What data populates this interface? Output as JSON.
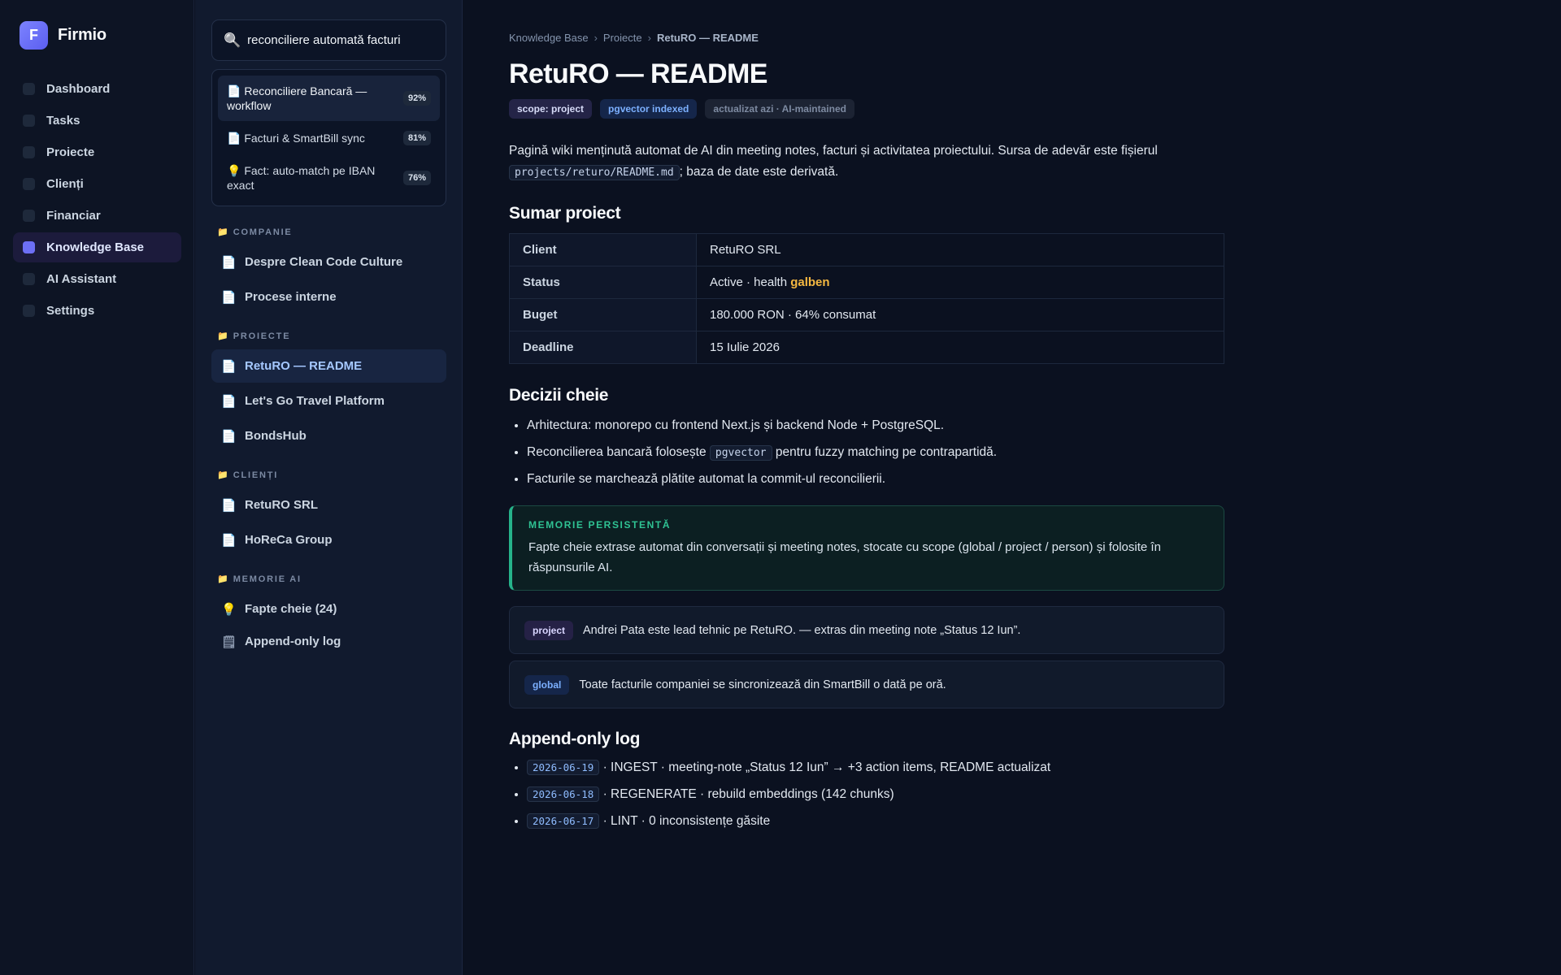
{
  "app": {
    "name": "Firmio",
    "logo_letter": "F"
  },
  "nav": {
    "items": [
      {
        "label": "Dashboard",
        "active": false
      },
      {
        "label": "Tasks",
        "active": false
      },
      {
        "label": "Proiecte",
        "active": false
      },
      {
        "label": "Clienți",
        "active": false
      },
      {
        "label": "Financiar",
        "active": false
      },
      {
        "label": "Knowledge Base",
        "active": true
      },
      {
        "label": "AI Assistant",
        "active": false
      },
      {
        "label": "Settings",
        "active": false
      }
    ]
  },
  "kb": {
    "search": {
      "value": "reconciliere automată facturi",
      "icon": "search-icon"
    },
    "results": [
      {
        "icon": "📄",
        "title": "Reconciliere Bancară — workflow",
        "score": "92%"
      },
      {
        "icon": "📄",
        "title": "Facturi & SmartBill sync",
        "score": "81%"
      },
      {
        "icon": "💡",
        "title": "Fact: auto-match pe IBAN exact",
        "score": "76%"
      }
    ],
    "sections": {
      "companie": {
        "label": "COMPANIE",
        "items": [
          {
            "label": "Despre Clean Code Culture"
          },
          {
            "label": "Procese interne"
          }
        ]
      },
      "proiecte": {
        "label": "PROIECTE",
        "items": [
          {
            "label": "RetuRO — README"
          },
          {
            "label": "Let's Go Travel Platform"
          },
          {
            "label": "BondsHub"
          }
        ]
      },
      "clienti": {
        "label": "CLIENȚI",
        "items": [
          {
            "label": "RetuRO SRL"
          },
          {
            "label": "HoReCa Group"
          }
        ]
      },
      "memorie": {
        "label": "MEMORIE AI",
        "items": [
          {
            "label": "Fapte cheie (24)"
          },
          {
            "label": "Append-only log"
          }
        ]
      }
    }
  },
  "main": {
    "breadcrumb": [
      "Knowledge Base",
      "Proiecte",
      "RetuRO — README"
    ],
    "breadcrumb_sep": "›",
    "title": "RetuRO — README",
    "badges": [
      "scope: project",
      "pgvector indexed",
      "actualizat azi · AI-maintained"
    ],
    "intro": {
      "text1": "Pagină wiki menținută automat de AI din meeting notes, facturi și activitatea proiectului. Sursa de adevăr este fișierul",
      "code": "projects/returo/README.md",
      "text2": "; baza de date este derivată."
    },
    "summary": {
      "heading": "Sumar proiect",
      "rows": [
        {
          "key": "Client",
          "value": "RetuRO SRL"
        },
        {
          "key": "Status",
          "value": "Active · health",
          "highlight": "galben"
        },
        {
          "key": "Buget",
          "value": "180.000 RON · 64% consumat"
        },
        {
          "key": "Deadline",
          "value": "15 Iulie 2026"
        }
      ],
      "highlight_color": "#f5b841"
    },
    "decisions": {
      "heading": "Decizii cheie",
      "items": [
        {
          "text": "Arhitectura: monorepo cu frontend Next.js și backend Node + PostgreSQL."
        },
        {
          "before": "Reconcilierea bancară folosește",
          "code": "pgvector",
          "after": "pentru fuzzy matching pe contrapartidă."
        },
        {
          "text": "Facturile se marchează plătite automat la commit-ul reconcilierii."
        }
      ]
    },
    "memory": {
      "label": "MEMORIE PERSISTENTĂ",
      "text": "Fapte cheie extrase automat din conversații și meeting notes, stocate cu scope (global / project / person) și folosite în răspunsurile AI.",
      "accent": "#26b38a"
    },
    "facts": [
      {
        "scope": "project",
        "text": "Andrei Pata este lead tehnic pe RetuRO. — extras din meeting note „Status 12 Iun”."
      },
      {
        "scope": "global",
        "text": "Toate facturile companiei se sincronizează din SmartBill o dată pe oră."
      }
    ],
    "log": {
      "heading": "Append-only log",
      "entries": [
        {
          "date": "2026-06-19",
          "text": "· INGEST · meeting-note „Status 12 Iun” → +3 action items, README actualizat"
        },
        {
          "date": "2026-06-18",
          "text": "· REGENERATE · rebuild embeddings (142 chunks)"
        },
        {
          "date": "2026-06-17",
          "text": "· LINT · 0 inconsistențe găsite"
        }
      ]
    }
  },
  "colors": {
    "accent": "#6d6ff5",
    "background": "#0b1120",
    "link": "#a5c8ff"
  }
}
